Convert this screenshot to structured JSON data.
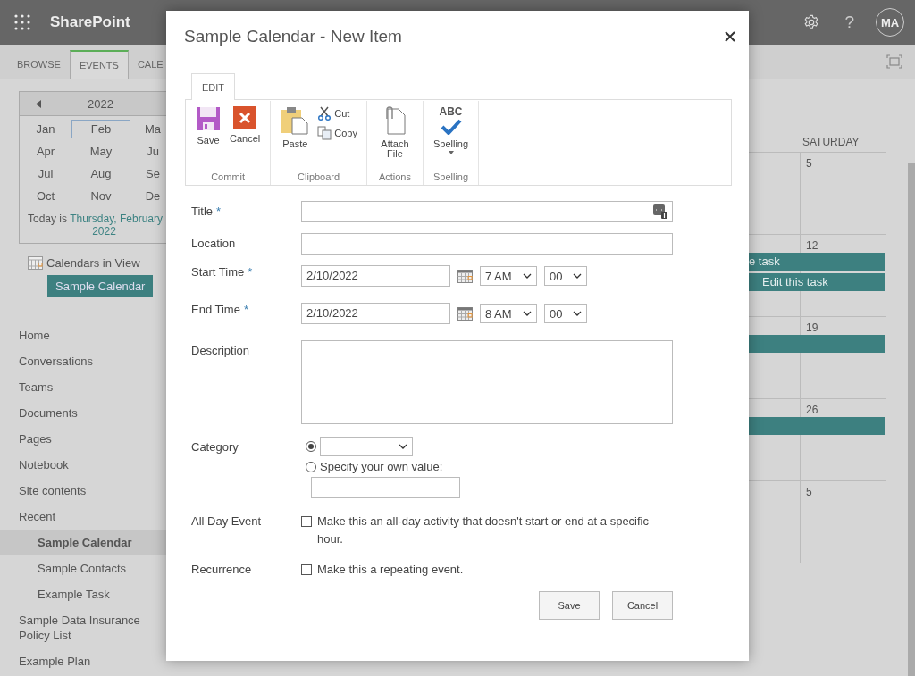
{
  "topbar": {
    "app_name": "SharePoint",
    "avatar_initials": "MA",
    "help": "?"
  },
  "ribbon_tabs": [
    {
      "label": "BROWSE",
      "selected": false
    },
    {
      "label": "EVENTS",
      "selected": true
    },
    {
      "label": "CALE",
      "selected": false
    }
  ],
  "date_picker": {
    "year": "2022",
    "months": [
      {
        "label": "Jan",
        "selected": false
      },
      {
        "label": "Feb",
        "selected": true
      },
      {
        "label": "Ma",
        "selected": false
      },
      {
        "label": "Apr",
        "selected": false
      },
      {
        "label": "May",
        "selected": false
      },
      {
        "label": "Ju",
        "selected": false
      },
      {
        "label": "Jul",
        "selected": false
      },
      {
        "label": "Aug",
        "selected": false
      },
      {
        "label": "Se",
        "selected": false
      },
      {
        "label": "Oct",
        "selected": false
      },
      {
        "label": "Nov",
        "selected": false
      },
      {
        "label": "De",
        "selected": false
      }
    ],
    "today_prefix": "Today is",
    "today_link": "Thursday, February",
    "today_year": "2022"
  },
  "calendars_in_view": {
    "label": "Calendars in View",
    "calendars": [
      "Sample Calendar"
    ]
  },
  "nav": [
    {
      "label": "Home",
      "selected": false
    },
    {
      "label": "Conversations",
      "selected": false
    },
    {
      "label": "Teams",
      "selected": false
    },
    {
      "label": "Documents",
      "selected": false
    },
    {
      "label": "Pages",
      "selected": false
    },
    {
      "label": "Notebook",
      "selected": false
    },
    {
      "label": "Site contents",
      "selected": false
    },
    {
      "label": "Recent",
      "selected": false,
      "children": [
        {
          "label": "Sample Calendar",
          "selected": true
        },
        {
          "label": "Sample Contacts",
          "selected": false
        },
        {
          "label": "Example Task",
          "selected": false
        }
      ]
    },
    {
      "label": "Sample Data Insurance Policy List",
      "selected": false
    },
    {
      "label": "Example Plan",
      "selected": false
    }
  ],
  "calendar": {
    "day_header": "SATURDAY",
    "weeks": [
      {
        "date": "5"
      },
      {
        "date": "12",
        "events": [
          {
            "kind": "labeled",
            "label": "e task"
          },
          {
            "kind": "labeled",
            "label": "Edit this task"
          }
        ]
      },
      {
        "date": "19",
        "events": [
          {
            "kind": "plain"
          }
        ]
      },
      {
        "date": "26",
        "events": [
          {
            "kind": "plain"
          }
        ]
      },
      {
        "date": "5"
      }
    ]
  },
  "dialog": {
    "title": "Sample Calendar - New Item",
    "ribbon_tab": "EDIT",
    "groups": [
      {
        "name": "Commit",
        "commands": [
          {
            "kind": "save",
            "label": "Save"
          },
          {
            "kind": "cancel",
            "label": "Cancel"
          }
        ]
      },
      {
        "name": "Clipboard",
        "commands": [
          {
            "kind": "paste",
            "label": "Paste"
          },
          {
            "kind": "cut",
            "label": "Cut"
          },
          {
            "kind": "copy",
            "label": "Copy"
          }
        ]
      },
      {
        "name": "Actions",
        "commands": [
          {
            "kind": "attach",
            "label": "Attach File"
          }
        ]
      },
      {
        "name": "Spelling",
        "commands": [
          {
            "kind": "spelling",
            "label": "Spelling",
            "badge": "ABC"
          }
        ]
      }
    ],
    "fields": [
      {
        "kind": "text",
        "label": "Title",
        "required_mark": "*"
      },
      {
        "kind": "text",
        "label": "Location"
      },
      {
        "kind": "datetime",
        "label": "Start Time",
        "required_mark": "*",
        "date": "2/10/2022",
        "hour": "7 AM",
        "minute": "00"
      },
      {
        "kind": "datetime",
        "label": "End Time",
        "required_mark": "*",
        "date": "2/10/2022",
        "hour": "8 AM",
        "minute": "00"
      },
      {
        "kind": "textarea",
        "label": "Description"
      },
      {
        "kind": "category",
        "label": "Category",
        "options": [
          {
            "kind": "dropdown",
            "selected": true
          },
          {
            "kind": "custom",
            "label": "Specify your own value:",
            "selected": false
          }
        ]
      },
      {
        "kind": "checkbox",
        "label": "All Day Event",
        "text": "Make this an all-day activity that doesn't start or end at a specific hour.",
        "checked": false
      },
      {
        "kind": "checkbox",
        "label": "Recurrence",
        "text": "Make this a repeating event.",
        "checked": false
      }
    ],
    "buttons": [
      "Save",
      "Cancel"
    ]
  }
}
